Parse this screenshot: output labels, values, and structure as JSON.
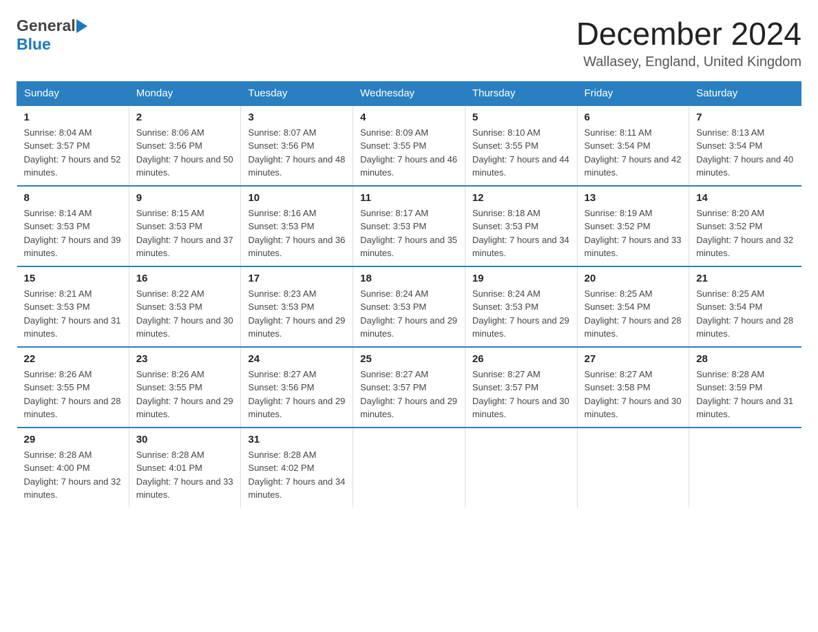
{
  "header": {
    "logo_general": "General",
    "logo_blue": "Blue",
    "month_title": "December 2024",
    "location": "Wallasey, England, United Kingdom"
  },
  "columns": [
    "Sunday",
    "Monday",
    "Tuesday",
    "Wednesday",
    "Thursday",
    "Friday",
    "Saturday"
  ],
  "weeks": [
    [
      {
        "day": "1",
        "sunrise": "8:04 AM",
        "sunset": "3:57 PM",
        "daylight": "7 hours and 52 minutes."
      },
      {
        "day": "2",
        "sunrise": "8:06 AM",
        "sunset": "3:56 PM",
        "daylight": "7 hours and 50 minutes."
      },
      {
        "day": "3",
        "sunrise": "8:07 AM",
        "sunset": "3:56 PM",
        "daylight": "7 hours and 48 minutes."
      },
      {
        "day": "4",
        "sunrise": "8:09 AM",
        "sunset": "3:55 PM",
        "daylight": "7 hours and 46 minutes."
      },
      {
        "day": "5",
        "sunrise": "8:10 AM",
        "sunset": "3:55 PM",
        "daylight": "7 hours and 44 minutes."
      },
      {
        "day": "6",
        "sunrise": "8:11 AM",
        "sunset": "3:54 PM",
        "daylight": "7 hours and 42 minutes."
      },
      {
        "day": "7",
        "sunrise": "8:13 AM",
        "sunset": "3:54 PM",
        "daylight": "7 hours and 40 minutes."
      }
    ],
    [
      {
        "day": "8",
        "sunrise": "8:14 AM",
        "sunset": "3:53 PM",
        "daylight": "7 hours and 39 minutes."
      },
      {
        "day": "9",
        "sunrise": "8:15 AM",
        "sunset": "3:53 PM",
        "daylight": "7 hours and 37 minutes."
      },
      {
        "day": "10",
        "sunrise": "8:16 AM",
        "sunset": "3:53 PM",
        "daylight": "7 hours and 36 minutes."
      },
      {
        "day": "11",
        "sunrise": "8:17 AM",
        "sunset": "3:53 PM",
        "daylight": "7 hours and 35 minutes."
      },
      {
        "day": "12",
        "sunrise": "8:18 AM",
        "sunset": "3:53 PM",
        "daylight": "7 hours and 34 minutes."
      },
      {
        "day": "13",
        "sunrise": "8:19 AM",
        "sunset": "3:52 PM",
        "daylight": "7 hours and 33 minutes."
      },
      {
        "day": "14",
        "sunrise": "8:20 AM",
        "sunset": "3:52 PM",
        "daylight": "7 hours and 32 minutes."
      }
    ],
    [
      {
        "day": "15",
        "sunrise": "8:21 AM",
        "sunset": "3:53 PM",
        "daylight": "7 hours and 31 minutes."
      },
      {
        "day": "16",
        "sunrise": "8:22 AM",
        "sunset": "3:53 PM",
        "daylight": "7 hours and 30 minutes."
      },
      {
        "day": "17",
        "sunrise": "8:23 AM",
        "sunset": "3:53 PM",
        "daylight": "7 hours and 29 minutes."
      },
      {
        "day": "18",
        "sunrise": "8:24 AM",
        "sunset": "3:53 PM",
        "daylight": "7 hours and 29 minutes."
      },
      {
        "day": "19",
        "sunrise": "8:24 AM",
        "sunset": "3:53 PM",
        "daylight": "7 hours and 29 minutes."
      },
      {
        "day": "20",
        "sunrise": "8:25 AM",
        "sunset": "3:54 PM",
        "daylight": "7 hours and 28 minutes."
      },
      {
        "day": "21",
        "sunrise": "8:25 AM",
        "sunset": "3:54 PM",
        "daylight": "7 hours and 28 minutes."
      }
    ],
    [
      {
        "day": "22",
        "sunrise": "8:26 AM",
        "sunset": "3:55 PM",
        "daylight": "7 hours and 28 minutes."
      },
      {
        "day": "23",
        "sunrise": "8:26 AM",
        "sunset": "3:55 PM",
        "daylight": "7 hours and 29 minutes."
      },
      {
        "day": "24",
        "sunrise": "8:27 AM",
        "sunset": "3:56 PM",
        "daylight": "7 hours and 29 minutes."
      },
      {
        "day": "25",
        "sunrise": "8:27 AM",
        "sunset": "3:57 PM",
        "daylight": "7 hours and 29 minutes."
      },
      {
        "day": "26",
        "sunrise": "8:27 AM",
        "sunset": "3:57 PM",
        "daylight": "7 hours and 30 minutes."
      },
      {
        "day": "27",
        "sunrise": "8:27 AM",
        "sunset": "3:58 PM",
        "daylight": "7 hours and 30 minutes."
      },
      {
        "day": "28",
        "sunrise": "8:28 AM",
        "sunset": "3:59 PM",
        "daylight": "7 hours and 31 minutes."
      }
    ],
    [
      {
        "day": "29",
        "sunrise": "8:28 AM",
        "sunset": "4:00 PM",
        "daylight": "7 hours and 32 minutes."
      },
      {
        "day": "30",
        "sunrise": "8:28 AM",
        "sunset": "4:01 PM",
        "daylight": "7 hours and 33 minutes."
      },
      {
        "day": "31",
        "sunrise": "8:28 AM",
        "sunset": "4:02 PM",
        "daylight": "7 hours and 34 minutes."
      },
      null,
      null,
      null,
      null
    ]
  ]
}
